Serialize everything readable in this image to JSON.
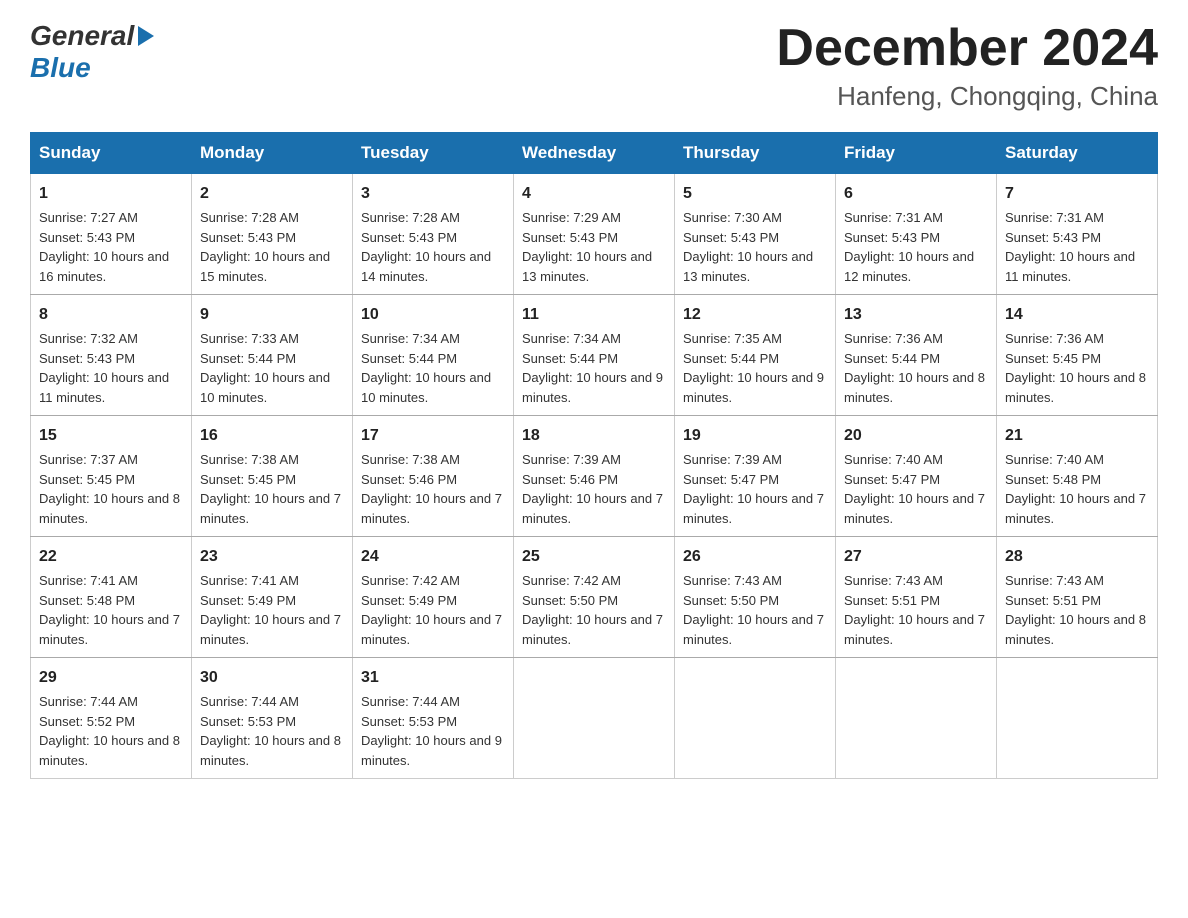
{
  "header": {
    "logo_general": "General",
    "logo_blue": "Blue",
    "month_title": "December 2024",
    "location": "Hanfeng, Chongqing, China"
  },
  "days_of_week": [
    "Sunday",
    "Monday",
    "Tuesday",
    "Wednesday",
    "Thursday",
    "Friday",
    "Saturday"
  ],
  "weeks": [
    [
      {
        "day": "1",
        "sunrise": "7:27 AM",
        "sunset": "5:43 PM",
        "daylight": "10 hours and 16 minutes."
      },
      {
        "day": "2",
        "sunrise": "7:28 AM",
        "sunset": "5:43 PM",
        "daylight": "10 hours and 15 minutes."
      },
      {
        "day": "3",
        "sunrise": "7:28 AM",
        "sunset": "5:43 PM",
        "daylight": "10 hours and 14 minutes."
      },
      {
        "day": "4",
        "sunrise": "7:29 AM",
        "sunset": "5:43 PM",
        "daylight": "10 hours and 13 minutes."
      },
      {
        "day": "5",
        "sunrise": "7:30 AM",
        "sunset": "5:43 PM",
        "daylight": "10 hours and 13 minutes."
      },
      {
        "day": "6",
        "sunrise": "7:31 AM",
        "sunset": "5:43 PM",
        "daylight": "10 hours and 12 minutes."
      },
      {
        "day": "7",
        "sunrise": "7:31 AM",
        "sunset": "5:43 PM",
        "daylight": "10 hours and 11 minutes."
      }
    ],
    [
      {
        "day": "8",
        "sunrise": "7:32 AM",
        "sunset": "5:43 PM",
        "daylight": "10 hours and 11 minutes."
      },
      {
        "day": "9",
        "sunrise": "7:33 AM",
        "sunset": "5:44 PM",
        "daylight": "10 hours and 10 minutes."
      },
      {
        "day": "10",
        "sunrise": "7:34 AM",
        "sunset": "5:44 PM",
        "daylight": "10 hours and 10 minutes."
      },
      {
        "day": "11",
        "sunrise": "7:34 AM",
        "sunset": "5:44 PM",
        "daylight": "10 hours and 9 minutes."
      },
      {
        "day": "12",
        "sunrise": "7:35 AM",
        "sunset": "5:44 PM",
        "daylight": "10 hours and 9 minutes."
      },
      {
        "day": "13",
        "sunrise": "7:36 AM",
        "sunset": "5:44 PM",
        "daylight": "10 hours and 8 minutes."
      },
      {
        "day": "14",
        "sunrise": "7:36 AM",
        "sunset": "5:45 PM",
        "daylight": "10 hours and 8 minutes."
      }
    ],
    [
      {
        "day": "15",
        "sunrise": "7:37 AM",
        "sunset": "5:45 PM",
        "daylight": "10 hours and 8 minutes."
      },
      {
        "day": "16",
        "sunrise": "7:38 AM",
        "sunset": "5:45 PM",
        "daylight": "10 hours and 7 minutes."
      },
      {
        "day": "17",
        "sunrise": "7:38 AM",
        "sunset": "5:46 PM",
        "daylight": "10 hours and 7 minutes."
      },
      {
        "day": "18",
        "sunrise": "7:39 AM",
        "sunset": "5:46 PM",
        "daylight": "10 hours and 7 minutes."
      },
      {
        "day": "19",
        "sunrise": "7:39 AM",
        "sunset": "5:47 PM",
        "daylight": "10 hours and 7 minutes."
      },
      {
        "day": "20",
        "sunrise": "7:40 AM",
        "sunset": "5:47 PM",
        "daylight": "10 hours and 7 minutes."
      },
      {
        "day": "21",
        "sunrise": "7:40 AM",
        "sunset": "5:48 PM",
        "daylight": "10 hours and 7 minutes."
      }
    ],
    [
      {
        "day": "22",
        "sunrise": "7:41 AM",
        "sunset": "5:48 PM",
        "daylight": "10 hours and 7 minutes."
      },
      {
        "day": "23",
        "sunrise": "7:41 AM",
        "sunset": "5:49 PM",
        "daylight": "10 hours and 7 minutes."
      },
      {
        "day": "24",
        "sunrise": "7:42 AM",
        "sunset": "5:49 PM",
        "daylight": "10 hours and 7 minutes."
      },
      {
        "day": "25",
        "sunrise": "7:42 AM",
        "sunset": "5:50 PM",
        "daylight": "10 hours and 7 minutes."
      },
      {
        "day": "26",
        "sunrise": "7:43 AM",
        "sunset": "5:50 PM",
        "daylight": "10 hours and 7 minutes."
      },
      {
        "day": "27",
        "sunrise": "7:43 AM",
        "sunset": "5:51 PM",
        "daylight": "10 hours and 7 minutes."
      },
      {
        "day": "28",
        "sunrise": "7:43 AM",
        "sunset": "5:51 PM",
        "daylight": "10 hours and 8 minutes."
      }
    ],
    [
      {
        "day": "29",
        "sunrise": "7:44 AM",
        "sunset": "5:52 PM",
        "daylight": "10 hours and 8 minutes."
      },
      {
        "day": "30",
        "sunrise": "7:44 AM",
        "sunset": "5:53 PM",
        "daylight": "10 hours and 8 minutes."
      },
      {
        "day": "31",
        "sunrise": "7:44 AM",
        "sunset": "5:53 PM",
        "daylight": "10 hours and 9 minutes."
      },
      null,
      null,
      null,
      null
    ]
  ]
}
